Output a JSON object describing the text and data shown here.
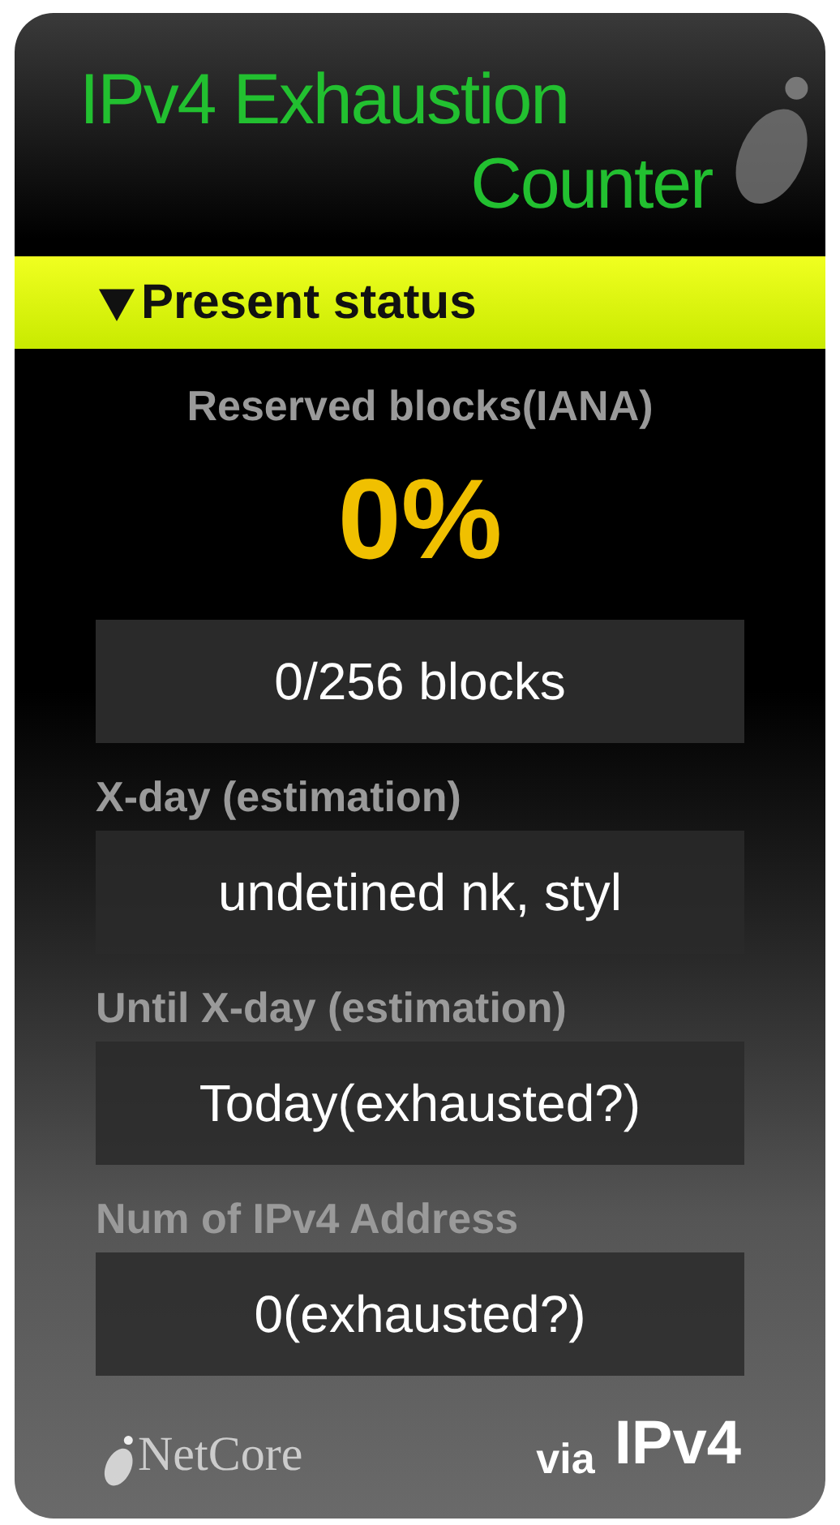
{
  "title": {
    "lines": [
      "IPv4 Exhaustion",
      "Counter"
    ]
  },
  "section": {
    "label": "Present status",
    "expanded": true
  },
  "reserved": {
    "label": "Reserved blocks(IANA)",
    "percent": "0%",
    "value": "0/256 blocks"
  },
  "fields": [
    {
      "label": "X-day (estimation)",
      "value": "undetined nk, styl"
    },
    {
      "label": "Until X-day (estimation)",
      "value": "Today(exhausted?)"
    },
    {
      "label": "Num of IPv4 Address",
      "value": "0(exhausted?)"
    }
  ],
  "footer": {
    "brand": "NetCore",
    "via": "via",
    "protocol": "IPv4"
  }
}
